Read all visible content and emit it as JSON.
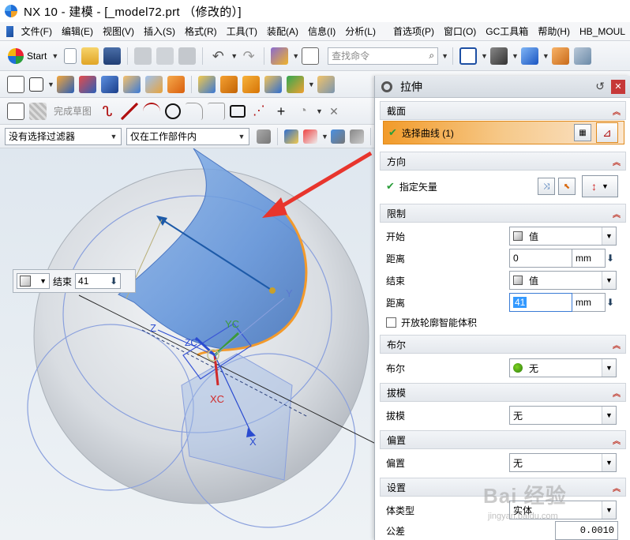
{
  "window": {
    "title": "NX 10 - 建模 - [_model72.prt （修改的）]"
  },
  "menu": [
    "文件(F)",
    "编辑(E)",
    "视图(V)",
    "插入(S)",
    "格式(R)",
    "工具(T)",
    "装配(A)",
    "信息(I)",
    "分析(L)",
    "首选项(P)",
    "窗口(O)",
    "GC工具箱",
    "帮助(H)",
    "HB_MOUL"
  ],
  "toolbar": {
    "start_label": "Start",
    "search_placeholder": "查找命令",
    "sketch_done": "完成草图",
    "filter_value": "没有选择过滤器",
    "scope_value": "仅在工作部件内"
  },
  "floating_input": {
    "label": "结束",
    "value": "41"
  },
  "dialog": {
    "title": "拉伸",
    "section_profile": "截面",
    "select_curve": "选择曲线 (1)",
    "section_direction": "方向",
    "specify_vector": "指定矢量",
    "section_limits": "限制",
    "start_label": "开始",
    "start_type": "值",
    "start_distance_label": "距离",
    "start_distance": "0",
    "end_label": "结束",
    "end_type": "值",
    "end_distance_label": "距离",
    "end_distance": "41",
    "unit": "mm",
    "open_profile_label": "开放轮廓智能体积",
    "section_boolean": "布尔",
    "boolean_label": "布尔",
    "boolean_value": "无",
    "section_draft": "拔模",
    "draft_label": "拔模",
    "draft_value": "无",
    "section_offset": "偏置",
    "offset_label": "偏置",
    "offset_value": "无",
    "section_settings": "设置",
    "body_type_label": "体类型",
    "body_type_value": "实体",
    "tolerance_label": "公差",
    "tolerance_value": "0.0010"
  },
  "viewport_labels": {
    "y": "Y",
    "yc": "YC",
    "z": "Z",
    "zc": "ZC",
    "xc": "XC",
    "x": "X"
  },
  "watermark": {
    "main": "Bai 经验",
    "sub": "jingyan.baidu.com"
  },
  "colors": {
    "selection_orange": "#f29b2a",
    "preview_blue": "#6fa3e0",
    "arrow_red": "#e8352d",
    "close_red": "#c63838"
  }
}
